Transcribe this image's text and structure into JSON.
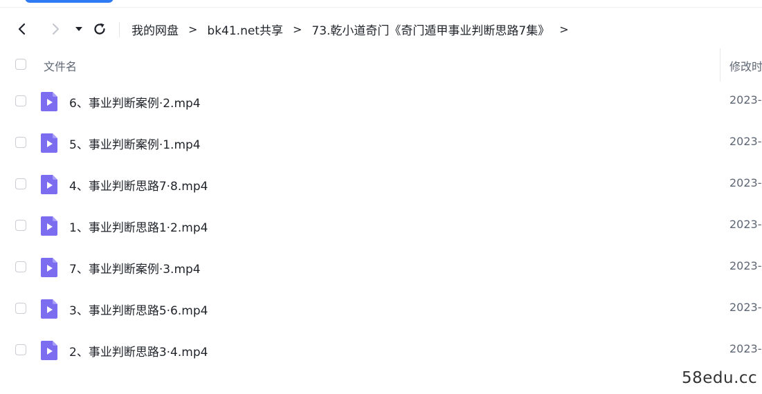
{
  "breadcrumb": [
    {
      "label": "我的网盘"
    },
    {
      "label": "bk41.net共享"
    },
    {
      "label": "73.乾小道奇门《奇门遁甲事业判断思路7集》"
    }
  ],
  "breadcrumb_separator": ">",
  "table": {
    "headers": {
      "name": "文件名",
      "modified": "修改时"
    },
    "rows": [
      {
        "name": "6、事业判断案例·2.mp4",
        "modified": "2023-"
      },
      {
        "name": "5、事业判断案例·1.mp4",
        "modified": "2023-"
      },
      {
        "name": "4、事业判断思路7·8.mp4",
        "modified": "2023-"
      },
      {
        "name": "1、事业判断思路1·2.mp4",
        "modified": "2023-"
      },
      {
        "name": "7、事业判断案例·3.mp4",
        "modified": "2023-"
      },
      {
        "name": "3、事业判断思路5·6.mp4",
        "modified": "2023-"
      },
      {
        "name": "2、事业判断思路3·4.mp4",
        "modified": "2023-"
      }
    ]
  },
  "icons": {
    "back": "chevron-left-icon",
    "forward": "chevron-right-icon",
    "history": "caret-down-icon",
    "refresh": "refresh-icon",
    "file": "video-file-icon"
  },
  "colors": {
    "accent": "#2f7bf6",
    "video_icon": "#7b6cf0"
  },
  "watermark": "58edu.cc"
}
